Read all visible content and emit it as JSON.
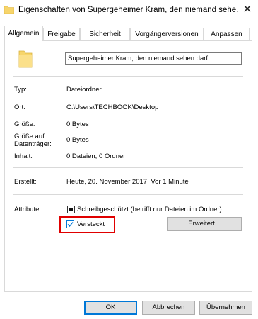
{
  "window": {
    "title": "Eigenschaften von Supergeheimer Kram, den niemand sehe…",
    "close_glyph": "✕"
  },
  "tabs": [
    {
      "label": "Allgemein",
      "active": true
    },
    {
      "label": "Freigabe"
    },
    {
      "label": "Sicherheit"
    },
    {
      "label": "Vorgängerversionen"
    },
    {
      "label": "Anpassen"
    }
  ],
  "general": {
    "folder_icon": "folder-icon",
    "name_value": "Supergeheimer Kram, den niemand sehen darf",
    "type_label": "Typ:",
    "type_value": "Dateiordner",
    "location_label": "Ort:",
    "location_value": "C:\\Users\\TECHBOOK\\Desktop",
    "size_label": "Größe:",
    "size_value": "0 Bytes",
    "size_on_disk_label_1": "Größe auf",
    "size_on_disk_label_2": "Datenträger:",
    "size_on_disk_value": "0 Bytes",
    "contents_label": "Inhalt:",
    "contents_value": "0 Dateien, 0 Ordner",
    "created_label": "Erstellt:",
    "created_value": "Heute, 20. November 2017, Vor 1 Minute",
    "attributes_label": "Attribute:",
    "readonly_label": "Schreibgeschützt (betrifft nur Dateien im Ordner)",
    "readonly_state": "indeterminate",
    "hidden_label": "Versteckt",
    "hidden_checked": true,
    "advanced_button": "Erweitert..."
  },
  "footer": {
    "ok": "OK",
    "cancel": "Abbrechen",
    "apply": "Übernehmen"
  },
  "colors": {
    "highlight": "#e00000",
    "accent": "#0078d7",
    "folder": "#f7d56b"
  }
}
